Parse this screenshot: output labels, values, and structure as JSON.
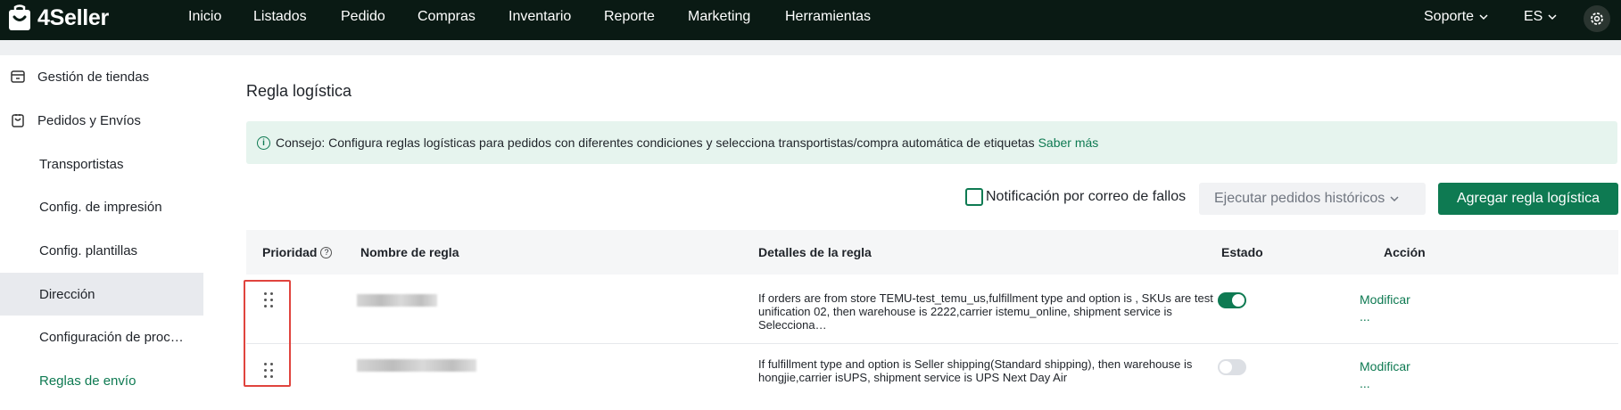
{
  "brand": {
    "name": "4Seller",
    "accent": "#0e7a52",
    "topbar_bg": "#0a1a14",
    "highlight_border": "#e0443e"
  },
  "nav": [
    {
      "label": "Inicio"
    },
    {
      "label": "Listados"
    },
    {
      "label": "Pedido"
    },
    {
      "label": "Compras"
    },
    {
      "label": "Inventario"
    },
    {
      "label": "Reporte"
    },
    {
      "label": "Marketing"
    },
    {
      "label": "Herramientas"
    }
  ],
  "top_right": {
    "support": "Soporte",
    "language": "ES",
    "settings_icon": "gear-icon"
  },
  "sidebar": {
    "items": [
      {
        "label": "Gestión de tiendas",
        "icon": "store-icon",
        "type": "parent"
      },
      {
        "label": "Pedidos y Envíos",
        "icon": "order-icon",
        "type": "parent"
      },
      {
        "label": "Transportistas",
        "type": "child"
      },
      {
        "label": "Config. de impresión",
        "type": "child"
      },
      {
        "label": "Config. plantillas",
        "type": "child"
      },
      {
        "label": "Dirección",
        "type": "child",
        "state": "hover"
      },
      {
        "label": "Configuración de proc…",
        "type": "child"
      },
      {
        "label": "Reglas de envío",
        "type": "child",
        "state": "selected"
      }
    ]
  },
  "main": {
    "title": "Regla logística",
    "tip": {
      "text": "Consejo: Configura reglas logísticas para pedidos con diferentes condiciones y selecciona transportistas/compra automática de etiquetas",
      "link": "Saber más"
    },
    "toolbar": {
      "notify_label": "Notificación por correo de fallos",
      "notify_checked": false,
      "history_dropdown": "Ejecutar pedidos históricos",
      "add_button": "Agregar regla logística"
    },
    "table": {
      "columns": [
        "Prioridad",
        "Nombre de regla",
        "Detalles de la regla",
        "Estado",
        "Acción"
      ],
      "rows": [
        {
          "details": "If orders are from store TEMU-test_temu_us,fulfillment type and option is , SKUs are test unification 02, then warehouse is 2222,carrier istemu_online, shipment service is Selecciona…",
          "enabled": true,
          "action": "Modificar",
          "more": "..."
        },
        {
          "details": "If fulfillment type and option is Seller shipping(Standard shipping), then warehouse is hongjie,carrier isUPS, shipment service is UPS Next Day Air",
          "enabled": false,
          "action": "Modificar",
          "more": "..."
        }
      ]
    }
  }
}
